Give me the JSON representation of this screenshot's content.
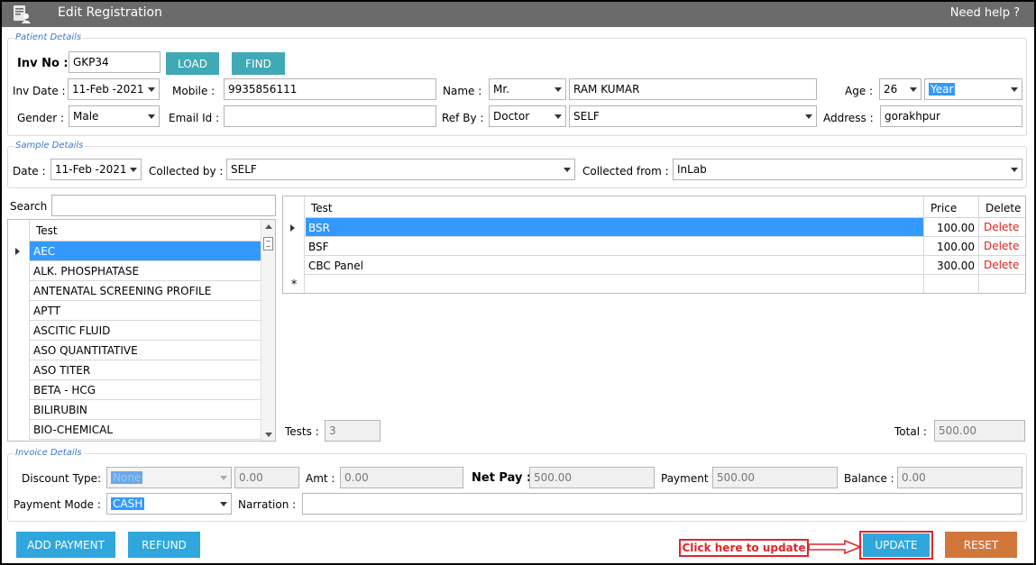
{
  "window": {
    "title": "Edit Registration",
    "help": "Need help ?"
  },
  "patient": {
    "legend": "Patient Details",
    "inv_no_label": "Inv No :",
    "inv_no_value": "GKP34",
    "load_label": "LOAD",
    "find_label": "FIND",
    "inv_date_label": "Inv Date :",
    "inv_date_value": "11-Feb -2021",
    "mobile_label": "Mobile :",
    "mobile_value": "9935856111",
    "name_label": "Name :",
    "title_value": "Mr.",
    "name_value": "RAM KUMAR",
    "age_label": "Age :",
    "age_value": "26",
    "age_unit": "Year",
    "gender_label": "Gender :",
    "gender_value": "Male",
    "email_label": "Email Id :",
    "email_value": "",
    "refby_label": "Ref By :",
    "refby_type": "Doctor",
    "refby_value": "SELF",
    "address_label": "Address :",
    "address_value": "gorakhpur"
  },
  "sample": {
    "legend": "Sample Details",
    "date_label": "Date :",
    "date_value": "11-Feb -2021",
    "collected_by_label": "Collected by :",
    "collected_by_value": "SELF",
    "collected_from_label": "Collected from :",
    "collected_from_value": "InLab"
  },
  "search": {
    "label": "Search",
    "value": ""
  },
  "test_list": {
    "header": "Test",
    "items": [
      "AEC",
      "ALK. PHOSPHATASE",
      "ANTENATAL SCREENING PROFILE",
      "APTT",
      "ASCITIC FLUID",
      "ASO QUANTITATIVE",
      "ASO TITER",
      "BETA - HCG",
      "BILIRUBIN",
      "BIO-CHEMICAL"
    ]
  },
  "selected_tests": {
    "headers": {
      "test": "Test",
      "price": "Price",
      "delete": "Delete"
    },
    "rows": [
      {
        "test": "BSR",
        "price": "100.00",
        "delete": "Delete"
      },
      {
        "test": "BSF",
        "price": "100.00",
        "delete": "Delete"
      },
      {
        "test": "CBC Panel",
        "price": "300.00",
        "delete": "Delete"
      }
    ],
    "tests_label": "Tests :",
    "tests_count": "3",
    "total_label": "Total :",
    "total_value": "500.00"
  },
  "invoice": {
    "legend": "Invoice Details",
    "discount_type_label": "Discount Type:",
    "discount_type_value": "None",
    "discount_value": "0.00",
    "amt_label": "Amt :",
    "amt_value": "0.00",
    "net_pay_label": "Net Pay :",
    "net_pay_value": "500.00",
    "payment_label": "Payment",
    "payment_value": "500.00",
    "balance_label": "Balance :",
    "balance_value": "0.00",
    "payment_mode_label": "Payment Mode :",
    "payment_mode_value": "CASH",
    "narration_label": "Narration :",
    "narration_value": ""
  },
  "actions": {
    "add_payment": "ADD PAYMENT",
    "refund": "REFUND",
    "callout": "Click here to update",
    "update": "UPDATE",
    "reset": "RESET"
  },
  "colors": {
    "accent_blue": "#2fa6dc",
    "teal": "#3fa9b5",
    "orange": "#d2773c",
    "annotation_red": "#e0262b",
    "selection": "#3399ff",
    "delete_red": "#e01e1e"
  }
}
